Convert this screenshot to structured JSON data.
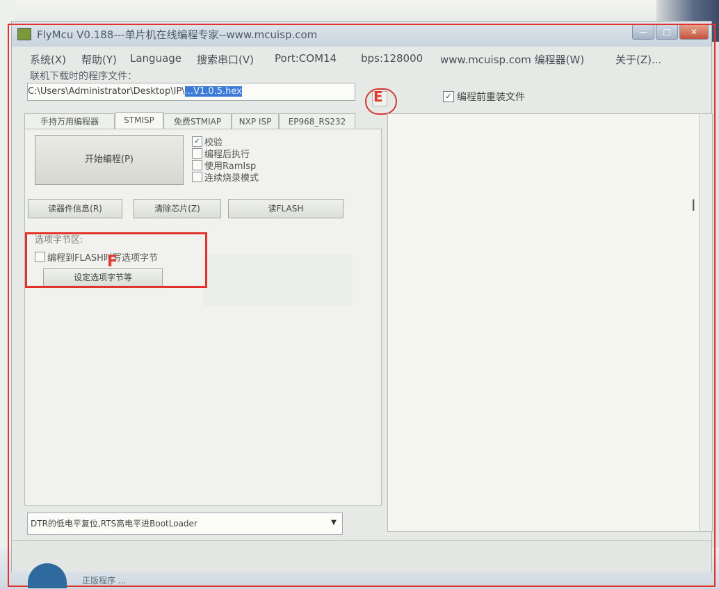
{
  "window": {
    "title": "FlyMcu V0.188---单片机在线编程专家--www.mcuisp.com",
    "controls": {
      "minimize": "—",
      "maximize": "□",
      "close": "✕"
    }
  },
  "menu": [
    "系统(X)",
    "帮助(Y)",
    "Language",
    "搜索串口(V)",
    "Port:COM14",
    "bps:128000",
    "www.mcuisp.com 编程器(W)",
    "关于(Z)..."
  ],
  "file": {
    "label": "联机下载时的程序文件：",
    "path_prefix": "C:\\Users\\Administrator\\Desktop\\IP\\",
    "path_selected": "...V1.0.5.hex"
  },
  "annotations": {
    "e": "E",
    "f": "F"
  },
  "reload_before_program": {
    "label": "编程前重装文件",
    "checked": true
  },
  "tabs": [
    "手持万用编程器",
    "STMISP",
    "免费STMIAP",
    "NXP ISP",
    "EP968_RS232"
  ],
  "active_tab": "STMISP",
  "controls": {
    "start_button": "开始编程(P)",
    "options": [
      {
        "label": "校验",
        "checked": true
      },
      {
        "label": "编程后执行",
        "checked": false
      },
      {
        "label": "使用RamIsp",
        "checked": false
      },
      {
        "label": "连续烧录模式",
        "checked": false
      }
    ],
    "read_device_info": "读器件信息(R)",
    "erase_chip": "清除芯片(Z)",
    "read_flash": "读FLASH",
    "option_bytes_title": "选项字节区:",
    "write_option_bytes": {
      "label": "编程到FLASH时写选项字节",
      "checked": false
    },
    "set_option_bytes": "设定选项字节等"
  },
  "boot_mode": {
    "selected": "DTR的低电平复位,RTS高电平进BootLoader",
    "arrow": "▼"
  },
  "log": {
    "cursor": "I"
  },
  "taskbar": {
    "text": "正版程序 ..."
  }
}
